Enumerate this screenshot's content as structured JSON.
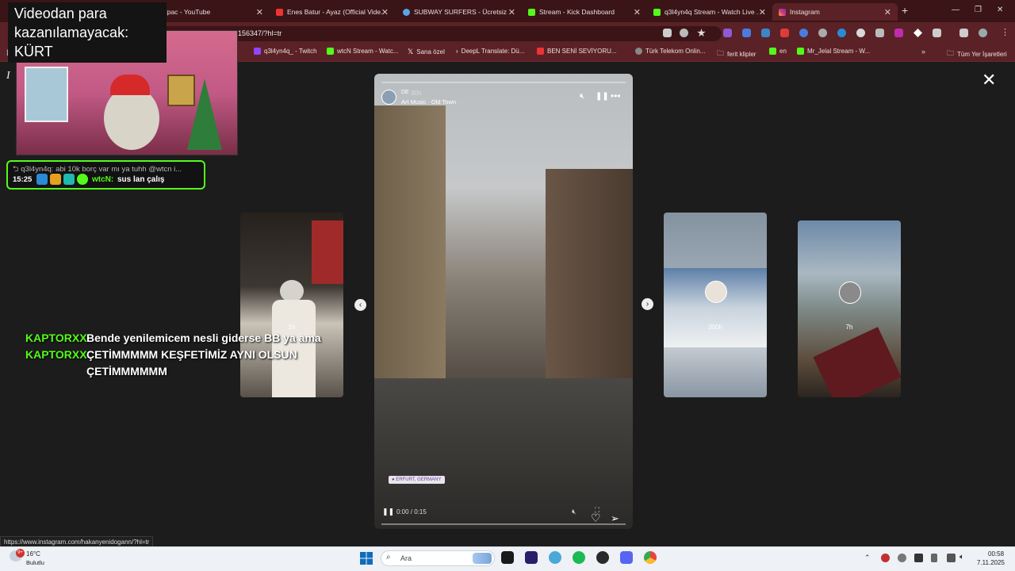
{
  "tabs": [
    {
      "title": "2pac - YouTube",
      "color": "#e33",
      "active": false
    },
    {
      "title": "Enes Batur - Ayaz (Official Vide...",
      "color": "#e33",
      "active": false
    },
    {
      "title": "SUBWAY SURFERS - Ücretsiz O...",
      "color": "#58a6e6",
      "active": false
    },
    {
      "title": "Stream - Kick Dashboard",
      "color": "#53fc18",
      "active": false
    },
    {
      "title": "q3l4yn4q Stream - Watch Live ...",
      "color": "#53fc18",
      "active": false
    },
    {
      "title": "Instagram",
      "color": "#d6338a",
      "active": true
    }
  ],
  "url": "156347/?hl=tr",
  "bookmarks": [
    {
      "label": "q3l4yn4q_ - Twitch",
      "color": "#9146ff"
    },
    {
      "label": "wtcN Stream - Watc...",
      "color": "#53fc18"
    },
    {
      "label": "Sana özel",
      "color": "#000"
    },
    {
      "label": "DeepL Translate: Dü...",
      "color": "#0f2b46"
    },
    {
      "label": "BEN SENİ SEVİYORU...",
      "color": "#e33"
    },
    {
      "label": "Türk Telekom Onlin...",
      "color": "#888"
    },
    {
      "label": "ferit klipler",
      "color": "#5a2226"
    },
    {
      "label": "en",
      "color": "#53fc18"
    },
    {
      "label": "Mr_Jelal Stream - W...",
      "color": "#53fc18"
    },
    {
      "label": "Tüm Yer İşaretleri",
      "color": "#5a2226"
    }
  ],
  "story": {
    "user": "DE",
    "time": "30h",
    "music": "Art Music · Old Town",
    "location": "● ERFURT, GERMANY",
    "player_time": "0:00 / 0:15"
  },
  "side_stories": {
    "left": "1h",
    "right1": "300h",
    "right2": "7h"
  },
  "overlay": {
    "title": "Videodan para kazanılamayacak: KÜRT",
    "chat_preview": "⮌ q3l4yn4q: abi 10k borç var mı ya tuhh @wtcn i...",
    "chat_time": "15:25",
    "chat_user": "wtcN:",
    "chat_msg": "sus lan çalış",
    "messages": [
      {
        "name": "KAPTORXX",
        "text": "Bende yenilemicem nesli giderse BB ya ama"
      },
      {
        "name": "KAPTORXX",
        "text": "ÇETİMMMMM KEŞFETİMİZ AYNI OLSUN"
      },
      {
        "name": "",
        "text": "ÇETİMMMMMM"
      }
    ]
  },
  "status_url": "https://www.instagram.com/hakanyenidogann/?hl=tr",
  "taskbar": {
    "weather_temp": "16°C",
    "weather_desc": "Bulutlu",
    "weather_badge": "9+",
    "search_placeholder": "Ara",
    "time": "00:58",
    "date": "7.11.2025"
  },
  "taskbar_apps": [
    {
      "name": "file-explorer-icon",
      "color": "#1a1a1a"
    },
    {
      "name": "premiere-icon",
      "color": "#2a1e6b"
    },
    {
      "name": "settings-icon",
      "color": "#4aa8d8"
    },
    {
      "name": "spotify-icon",
      "color": "#1db954"
    },
    {
      "name": "obs-icon",
      "color": "#2a2a2a"
    },
    {
      "name": "discord-icon",
      "color": "#5865f2"
    },
    {
      "name": "chrome-icon",
      "color": "#e8453c"
    }
  ]
}
